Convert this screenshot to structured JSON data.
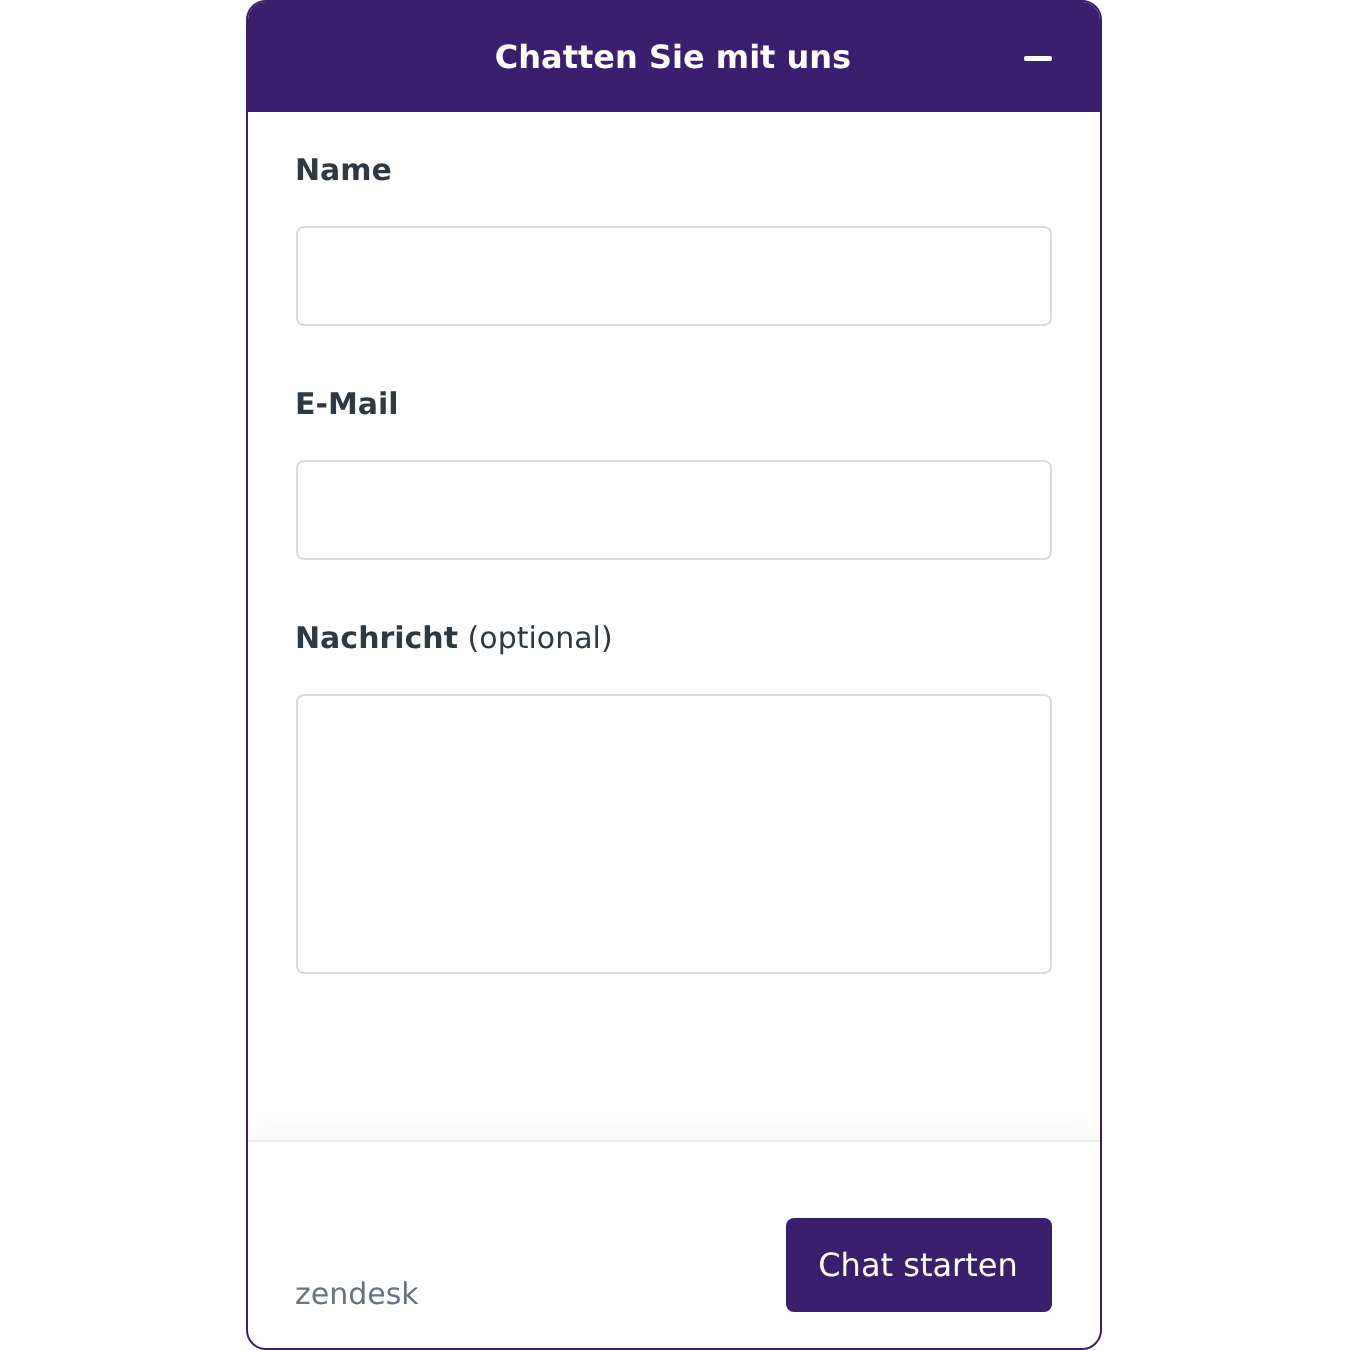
{
  "header": {
    "title": "Chatten Sie mit uns"
  },
  "fields": [
    {
      "label": "Name",
      "kind": "input"
    },
    {
      "label": "E-Mail",
      "kind": "input"
    },
    {
      "label": "**Nachricht** (optional)",
      "kind": "textarea"
    }
  ],
  "footer": {
    "brand": "zendesk",
    "button": "Chat starten"
  }
}
